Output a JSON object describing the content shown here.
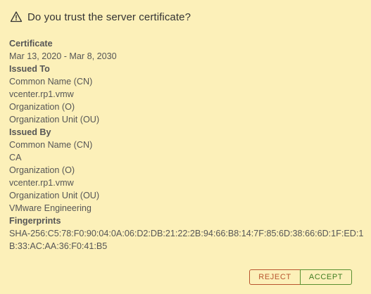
{
  "dialog": {
    "title": "Do you trust the server certificate?",
    "icon": "warning-triangle-icon"
  },
  "certificate": {
    "heading": "Certificate",
    "validity": "Mar 13, 2020 - Mar 8, 2030",
    "issued_to": {
      "heading": "Issued To",
      "cn_label": "Common Name (CN)",
      "cn_value": "vcenter.rp1.vmw",
      "o_label": "Organization (O)",
      "ou_label": "Organization Unit (OU)"
    },
    "issued_by": {
      "heading": "Issued By",
      "cn_label": "Common Name (CN)",
      "cn_value": "CA",
      "o_label": "Organization (O)",
      "o_value": "vcenter.rp1.vmw",
      "ou_label": "Organization Unit (OU)",
      "ou_value": "VMware Engineering"
    },
    "fingerprints": {
      "heading": "Fingerprints",
      "sha256": "SHA-256:C5:78:F0:90:04:0A:06:D2:DB:21:22:2B:94:66:B8:14:7F:85:6D:38:66:6D:1F:ED:1B:33:AC:AA:36:F0:41:B5"
    }
  },
  "buttons": {
    "reject_label": "REJECT",
    "accept_label": "ACCEPT"
  },
  "colors": {
    "background": "#fcf0b9",
    "reject": "#b8552e",
    "accept": "#3f7d22"
  }
}
